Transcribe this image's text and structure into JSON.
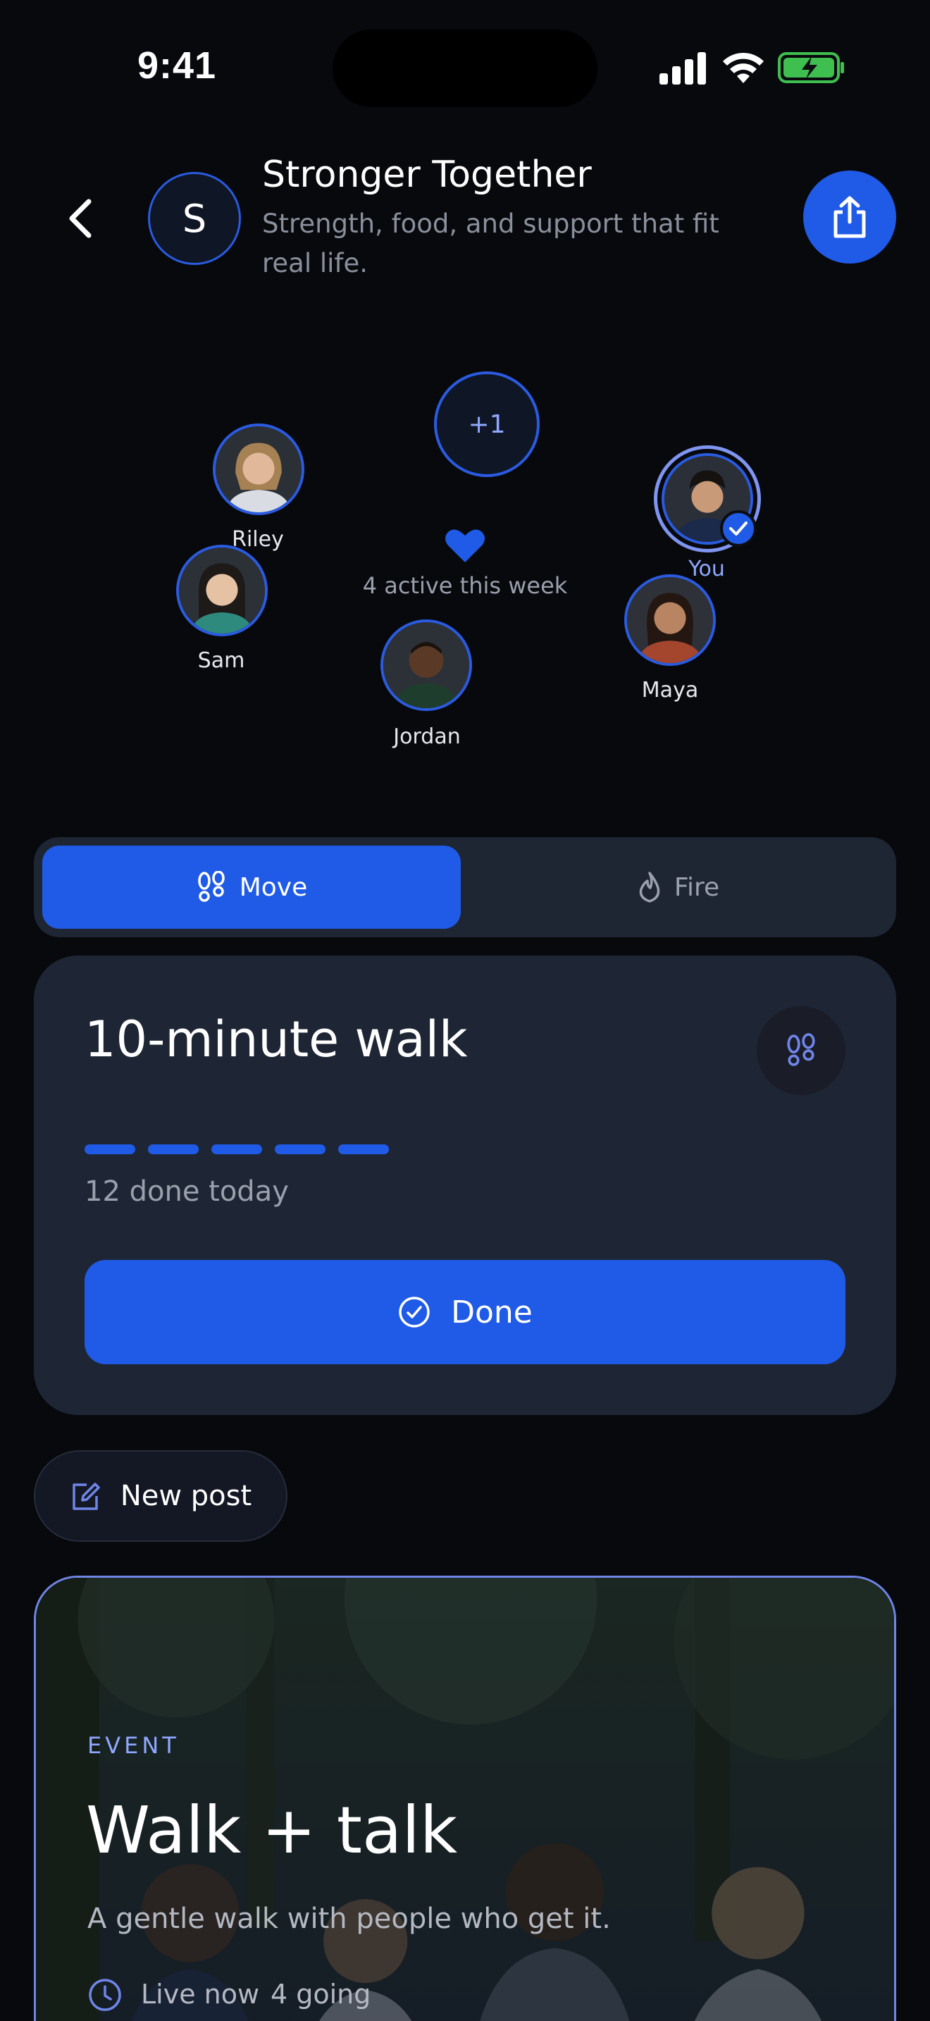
{
  "status_bar": {
    "time": "9:41"
  },
  "header": {
    "group_initial": "S",
    "title": "Stronger Together",
    "subtitle": "Strength, food, and support that fit real life."
  },
  "members": {
    "overflow": "+1",
    "people": [
      {
        "name": "Riley"
      },
      {
        "name": "Sam"
      },
      {
        "name": "Jordan"
      },
      {
        "name": "Maya"
      },
      {
        "name": "You"
      }
    ],
    "active_text": "4 active this week"
  },
  "tabs": {
    "move": "Move",
    "fire": "Fire"
  },
  "activity": {
    "title": "10-minute walk",
    "progress_dashes": 5,
    "done_count": "12 done today",
    "done_label": "Done"
  },
  "new_post": {
    "label": "New post"
  },
  "event": {
    "label": "EVENT",
    "title": "Walk + talk",
    "subtitle": "A gentle walk with people who get it.",
    "status": "Live now",
    "going": "4 going"
  },
  "colors": {
    "background": "#08090d",
    "accent": "#1f5be6",
    "card": "#1e2635",
    "muted_text": "#9aa0ac",
    "highlight": "#8fa8ff"
  }
}
